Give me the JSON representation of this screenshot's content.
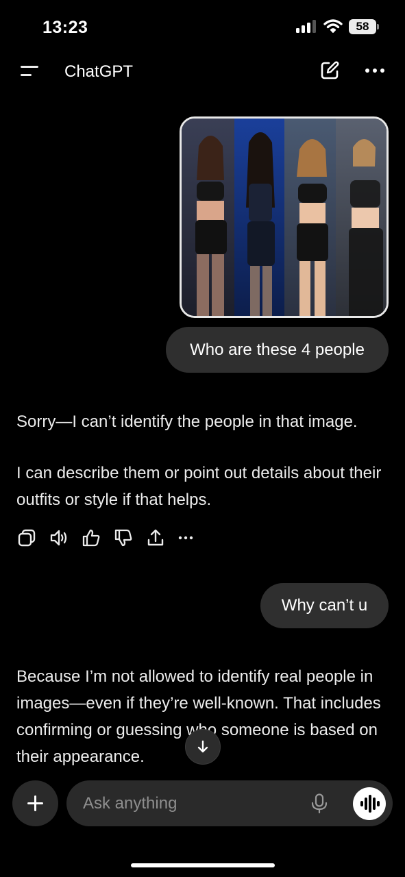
{
  "status_bar": {
    "time": "13:23",
    "battery": "58",
    "signal_icon": "cellular-signal-icon",
    "wifi_icon": "wifi-icon"
  },
  "header": {
    "title": "ChatGPT",
    "menu_icon": "menu-icon",
    "new_chat_icon": "new-chat-icon",
    "more_icon": "more-options-icon"
  },
  "conversation": {
    "user_image_description_icon": "image-thumbnail",
    "user_message_1": "Who are these 4 people",
    "assistant_reply_1_p1": "Sorry—I can’t identify the people in that image.",
    "assistant_reply_1_p2": "I can describe them or point out details about their outfits or style if that helps.",
    "user_message_2": "Why can’t u",
    "assistant_reply_2": "Because I’m not allowed to identify real people in images—even if they’re well-known. That includes confirming or guessing who someone is based on their appearance.",
    "action_icons": [
      "copy-icon",
      "read-aloud-icon",
      "thumbs-up-icon",
      "thumbs-down-icon",
      "share-icon",
      "more-icon"
    ]
  },
  "composer": {
    "placeholder": "Ask anything",
    "plus_icon": "plus-icon",
    "mic_icon": "microphone-icon",
    "voice_icon": "voice-mode-icon"
  },
  "colors": {
    "background": "#000000",
    "bubble": "#2f2f2f",
    "composer": "#2a2a2a",
    "text": "#ececec"
  }
}
